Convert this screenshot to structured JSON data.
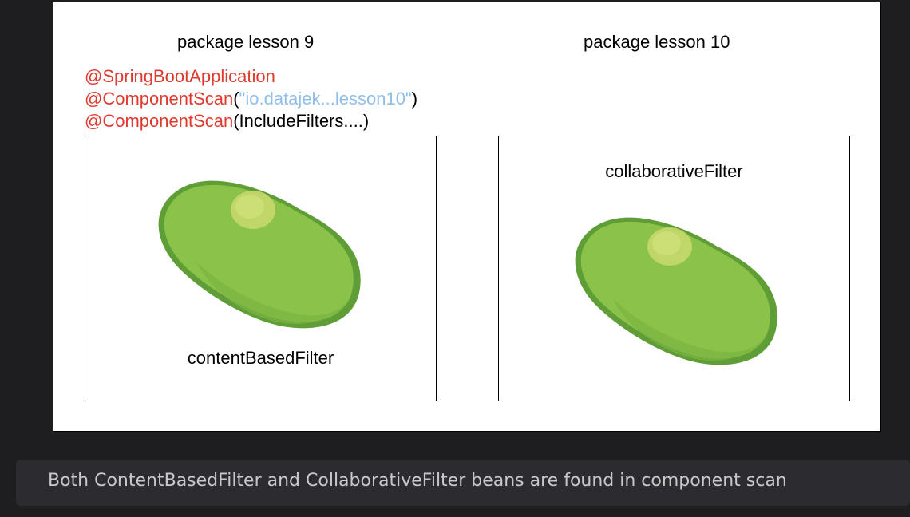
{
  "diagram": {
    "left_package_title": "package lesson 9",
    "right_package_title": "package lesson 10",
    "annotations": {
      "line1": "@SpringBootApplication",
      "line2_prefix": "@ComponentScan",
      "line2_paren_open": "(",
      "line2_string": "\"io.datajek...lesson10\"",
      "line2_paren_close": ")",
      "line3_prefix": "@ComponentScan",
      "line3_rest": "(IncludeFilters....)"
    },
    "left_bean_label": "contentBasedFilter",
    "right_bean_label": "collaborativeFilter",
    "colors": {
      "annotation_red": "#e03a2f",
      "string_blue": "#8fbfea",
      "bean_green": "#8bc34a",
      "bean_dark": "#5f9e36",
      "bean_highlight": "#c5d86d"
    }
  },
  "caption": {
    "text": "Both ContentBasedFilter and CollaborativeFilter beans are found in component scan"
  }
}
